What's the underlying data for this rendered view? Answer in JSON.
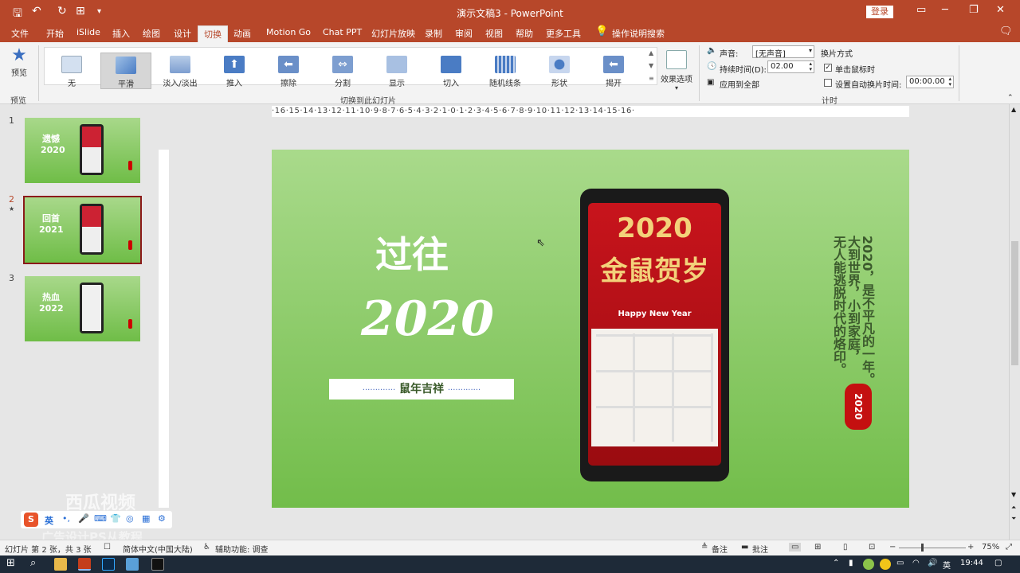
{
  "title": "演示文稿3 - PowerPoint",
  "login_label": "登录",
  "tabs": [
    "文件",
    "开始",
    "iSlide",
    "插入",
    "绘图",
    "设计",
    "切换",
    "动画",
    "Motion Go",
    "Chat PPT",
    "幻灯片放映",
    "录制",
    "审阅",
    "视图",
    "帮助",
    "更多工具"
  ],
  "active_tab": "切换",
  "tell_me": "操作说明搜索",
  "ribbon": {
    "preview_label": "预览",
    "preview_group": "预览",
    "transitions": [
      "无",
      "平滑",
      "淡入/淡出",
      "推入",
      "擦除",
      "分割",
      "显示",
      "切入",
      "随机线条",
      "形状",
      "揭开"
    ],
    "selected_transition": "平滑",
    "effect_options": "效果选项",
    "transition_group": "切换到此幻灯片",
    "sound_label": "声音:",
    "sound_value": "[无声音]",
    "duration_label": "持续时间(D):",
    "duration_value": "02.00",
    "apply_all": "应用到全部",
    "advance_label": "换片方式",
    "on_click": "单击鼠标时",
    "after_label": "设置自动换片时间:",
    "after_value": "00:00.00",
    "timing_group": "计时"
  },
  "slides": {
    "numbers": [
      "1",
      "2",
      "3"
    ],
    "active": "2",
    "star": "★",
    "thumb_titles": [
      "2020",
      "2021",
      "2022"
    ],
    "thumb_subtitles": [
      "遗憾",
      "回首",
      "热血"
    ]
  },
  "ruler_text": "·16·15·14·13·12·11·10·9·8·7·6·5·4·3·2·1·0·1·2·3·4·5·6·7·8·9·10·11·12·13·14·15·16·",
  "slide": {
    "heading": "过往",
    "year": "2020",
    "banner_dots": "·············",
    "banner": "鼠年吉祥",
    "phone_year": "2020",
    "phone_title": "金鼠贺岁",
    "phone_sub": "Happy New Year",
    "vertical_text_1": "2020，是不平凡的一年。",
    "vertical_text_2": "大到世界，小到家庭，",
    "vertical_text_3": "无人能逃脱时代的烙印。",
    "seal": "2020"
  },
  "status": {
    "slide_info": "幻灯片 第 2 张，共 3 张",
    "language": "简体中文(中国大陆)",
    "accessibility": "辅助功能: 调查",
    "notes": "备注",
    "comments": "批注",
    "zoom": "75%"
  },
  "taskbar": {
    "time": "19:44",
    "ime": "英"
  },
  "ime_bar": {
    "mode": "英"
  },
  "watermark": {
    "line1": "西瓜视频",
    "line2": "广告设计PS从教程"
  }
}
